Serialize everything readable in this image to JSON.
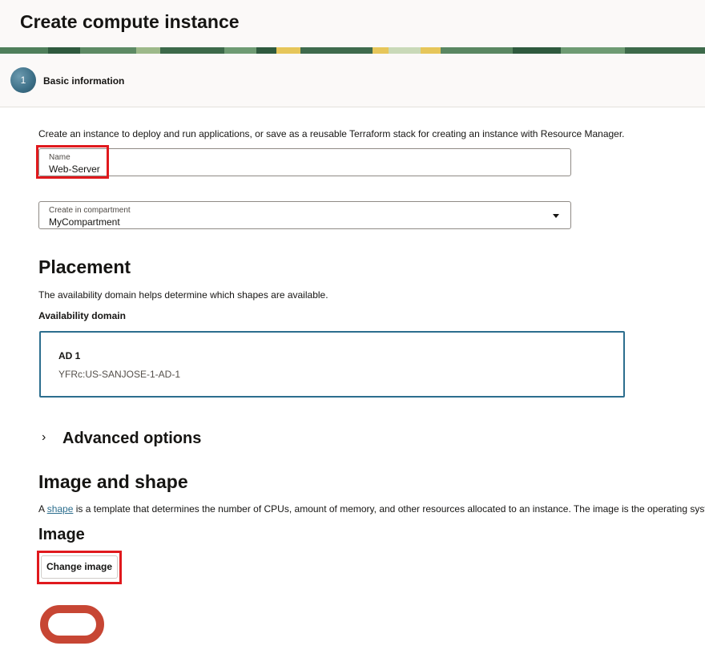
{
  "header": {
    "title": "Create compute instance"
  },
  "steps": [
    {
      "number": "1",
      "label": "Basic information"
    }
  ],
  "intro": "Create an instance to deploy and run applications, or save as a reusable Terraform stack for creating an instance with Resource Manager.",
  "name_field": {
    "label": "Name",
    "value": "Web-Server"
  },
  "compartment_field": {
    "label": "Create in compartment",
    "value": "MyCompartment"
  },
  "placement": {
    "title": "Placement",
    "description": "The availability domain helps determine which shapes are available.",
    "ad_label": "Availability domain",
    "ad_card": {
      "name": "AD 1",
      "id": "YFRc:US-SANJOSE-1-AD-1"
    }
  },
  "advanced": {
    "title": "Advanced options"
  },
  "image_shape": {
    "title": "Image and shape",
    "desc_prefix": "A ",
    "desc_link": "shape",
    "desc_rest": " is a template that determines the number of CPUs, amount of memory, and other resources allocated to an instance. The image is the operating syster",
    "image_title": "Image",
    "change_image_button": "Change image"
  },
  "colors": {
    "accent": "#2c6e8e",
    "highlight": "#e0191d",
    "oracle_red": "#c74634"
  }
}
